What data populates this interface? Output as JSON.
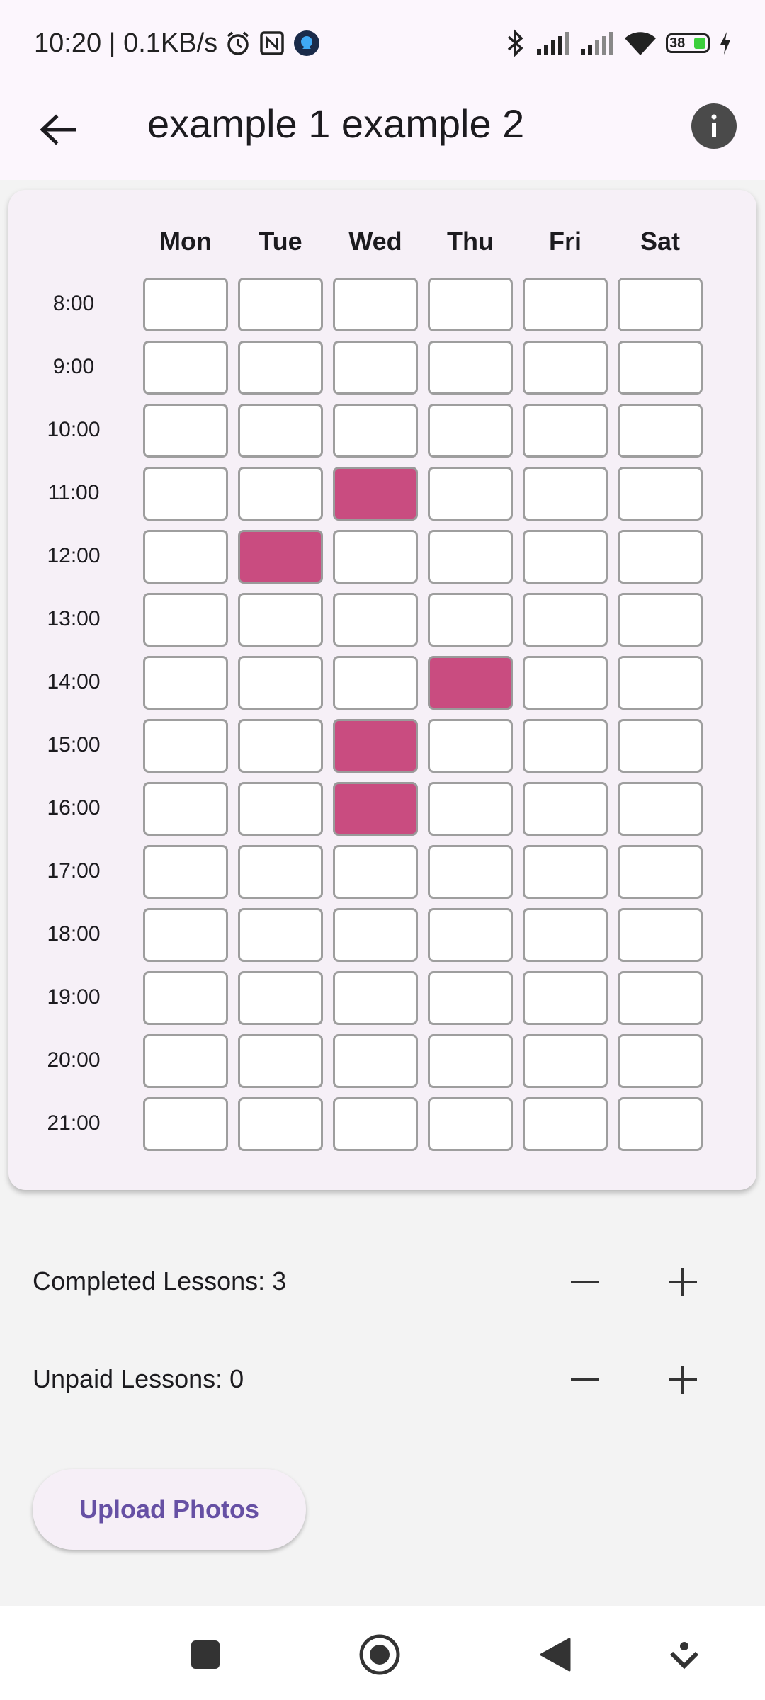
{
  "status_bar": {
    "time_speed": "10:20 | 0.1KB/s",
    "battery_level": "38"
  },
  "app_bar": {
    "title": "example 1 example 2"
  },
  "schedule": {
    "days": [
      "Mon",
      "Tue",
      "Wed",
      "Thu",
      "Fri",
      "Sat"
    ],
    "times": [
      "8:00",
      "9:00",
      "10:00",
      "11:00",
      "12:00",
      "13:00",
      "14:00",
      "15:00",
      "16:00",
      "17:00",
      "18:00",
      "19:00",
      "20:00",
      "21:00"
    ],
    "booked_slots": [
      {
        "day": "Wed",
        "time": "11:00"
      },
      {
        "day": "Tue",
        "time": "12:00"
      },
      {
        "day": "Thu",
        "time": "14:00"
      },
      {
        "day": "Wed",
        "time": "15:00"
      },
      {
        "day": "Wed",
        "time": "16:00"
      }
    ],
    "booked_color": "#c94c80"
  },
  "counters": {
    "completed_label": "Completed Lessons: 3",
    "unpaid_label": "Unpaid Lessons: 0"
  },
  "actions": {
    "upload_label": "Upload Photos"
  },
  "colors": {
    "accent": "#6650a4",
    "app_bar_bg": "#fcf6fd"
  }
}
